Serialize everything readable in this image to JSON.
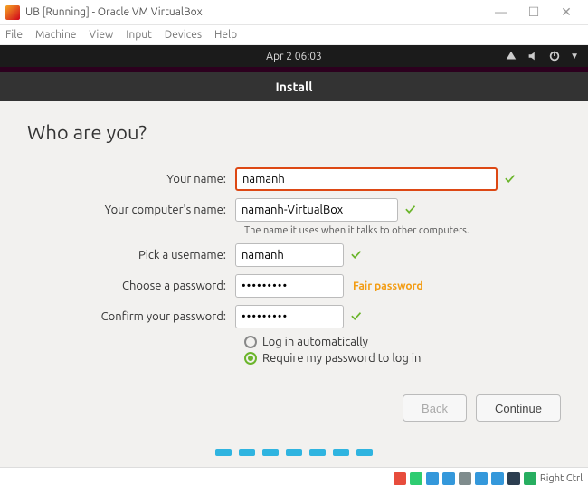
{
  "window": {
    "title": "UB [Running] - Oracle VM VirtualBox",
    "min": "—",
    "max": "☐",
    "close": "✕"
  },
  "menu": {
    "file": "File",
    "machine": "Machine",
    "view": "View",
    "input": "Input",
    "devices": "Devices",
    "help": "Help"
  },
  "ubuntu_bar": {
    "datetime": "Apr 2  06:03"
  },
  "installer": {
    "header": "Install",
    "title": "Who are you?",
    "labels": {
      "name": "Your name:",
      "computer": "Your computer's name:",
      "computer_hint": "The name it uses when it talks to other computers.",
      "username": "Pick a username:",
      "password": "Choose a password:",
      "confirm": "Confirm your password:"
    },
    "values": {
      "name": "namanh",
      "computer": "namanh-VirtualBox",
      "username": "namanh",
      "password": "•••••••••",
      "confirm": "•••••••••"
    },
    "strength": "Fair password",
    "check": "✓",
    "radios": {
      "auto": "Log in automatically",
      "require": "Require my password to log in"
    },
    "buttons": {
      "back": "Back",
      "continue": "Continue"
    }
  },
  "statusbar": {
    "hostkey": "Right Ctrl"
  }
}
